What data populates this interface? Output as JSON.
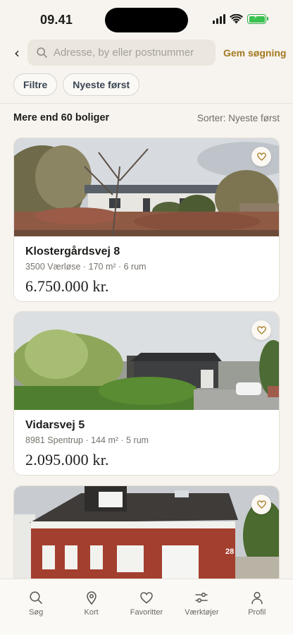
{
  "status": {
    "time": "09.41"
  },
  "search": {
    "placeholder": "Adresse, by eller postnummer",
    "value": ""
  },
  "header": {
    "back_icon": "chevron-left-icon",
    "save_search_label": "Gem søgning"
  },
  "filters": {
    "filter_label": "Filtre",
    "sort_chip_label": "Nyeste først"
  },
  "results": {
    "count_label": "Mere end 60 boliger",
    "sort_label": "Sorter: Nyeste først"
  },
  "listings": [
    {
      "title": "Klostergårdsvej 8",
      "meta": "3500 Værløse · 170 m² · 6 rum",
      "price": "6.750.000 kr."
    },
    {
      "title": "Vidarsvej 5",
      "meta": "8981 Spentrup · 144 m² · 5 rum",
      "price": "2.095.000 kr."
    },
    {
      "title": "",
      "meta": "",
      "price": "",
      "house_number": "28"
    }
  ],
  "nav": [
    {
      "label": "Søg",
      "icon": "search-icon"
    },
    {
      "label": "Kort",
      "icon": "map-pin-icon"
    },
    {
      "label": "Favoritter",
      "icon": "heart-icon"
    },
    {
      "label": "Værktøjer",
      "icon": "sliders-icon"
    },
    {
      "label": "Profil",
      "icon": "profile-icon"
    }
  ],
  "colors": {
    "accent": "#a3781f",
    "background": "#f7f4ef",
    "card": "#ffffff",
    "battery": "#39c24f"
  }
}
